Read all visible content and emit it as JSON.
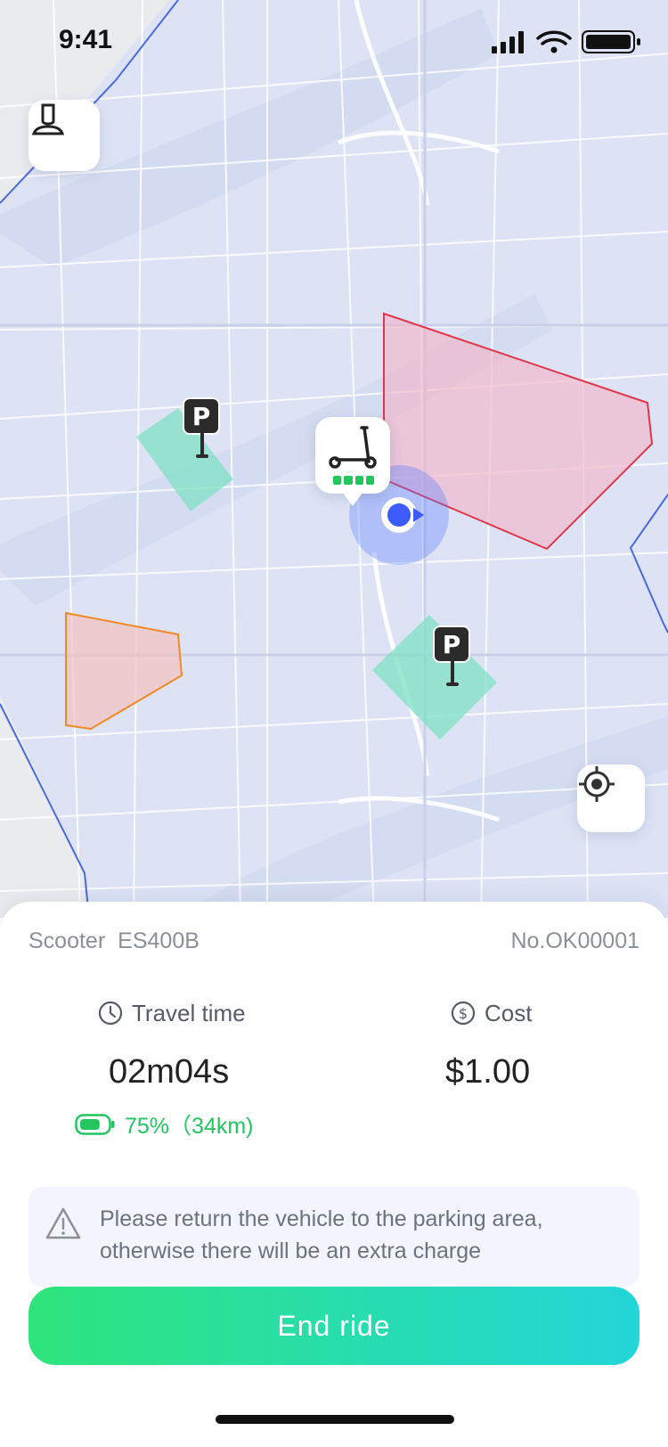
{
  "status_bar": {
    "time": "9:41"
  },
  "colors": {
    "accent_gradient_start": "#2ee57c",
    "accent_gradient_end": "#22d6d9",
    "battery_green": "#22c55e",
    "restricted_zone_red": "#e0364a",
    "restricted_zone_orange": "#f08a24",
    "parking_zone_teal": "#7fe0c4",
    "user_location_blue": "#3b5bff"
  },
  "map": {
    "scooter_marker": {
      "icon": "scooter-icon",
      "battery_bars": 4
    },
    "parking_pin_label": "P",
    "locate_icon": "crosshair-icon",
    "profile_icon": "user-icon"
  },
  "ride": {
    "vehicle_type": "Scooter",
    "model": "ES400B",
    "vehicle_no": "No.OK00001",
    "travel_time_label": "Travel time",
    "travel_time_value": "02m04s",
    "cost_label": "Cost",
    "cost_value": "$1.00",
    "battery_text": "75%（34km)",
    "battery_level": 0.75
  },
  "warning": {
    "icon": "warning-icon",
    "text": "Please return the vehicle to the parking area, otherwise there will be an extra charge"
  },
  "actions": {
    "end_ride_label": "End ride"
  }
}
